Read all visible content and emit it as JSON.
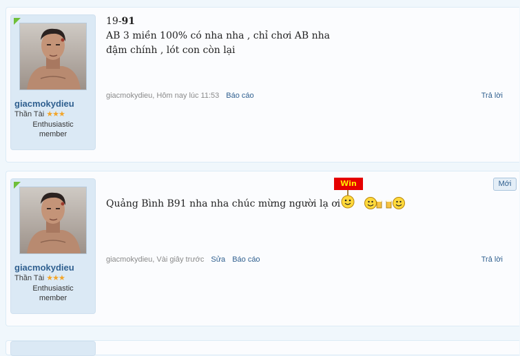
{
  "posts": [
    {
      "username": "giacmokydieu",
      "rank_title": "Thần Tài",
      "rank_stars": "★★★",
      "rank_desc_line1": "Enthusiastic",
      "rank_desc_line2": "member",
      "line1_prefix": "19-",
      "line1_bold": "91",
      "line2": "AB 3 miền 100% có nha nha , chỉ chơi AB nha",
      "line3": "đậm chính , lót con còn lại",
      "meta_author": "giacmokydieu, Hôm nay lúc 11:53",
      "report_label": "Báo cáo",
      "reply_label": "Trả lời"
    },
    {
      "username": "giacmokydieu",
      "rank_title": "Thần Tài",
      "rank_stars": "★★★",
      "rank_desc_line1": "Enthusiastic",
      "rank_desc_line2": "member",
      "message": "Quảng Bình B91 nha nha chúc mừng người lạ ơi !!",
      "meta_author": "giacmokydieu, Vài giây trước",
      "edit_label": "Sửa",
      "report_label": "Báo cáo",
      "reply_label": "Trả lời",
      "new_badge": "Mới",
      "win_sign": "Win",
      "emoticons": [
        "win-sign-smiley-icon",
        "beer-toast-smiley-icon"
      ]
    }
  ],
  "colors": {
    "background": "#f0f7fc",
    "link": "#2f5f8f",
    "user_card": "#dbe9f5",
    "star": "#f2a52a",
    "win_sign": "#e50000"
  }
}
